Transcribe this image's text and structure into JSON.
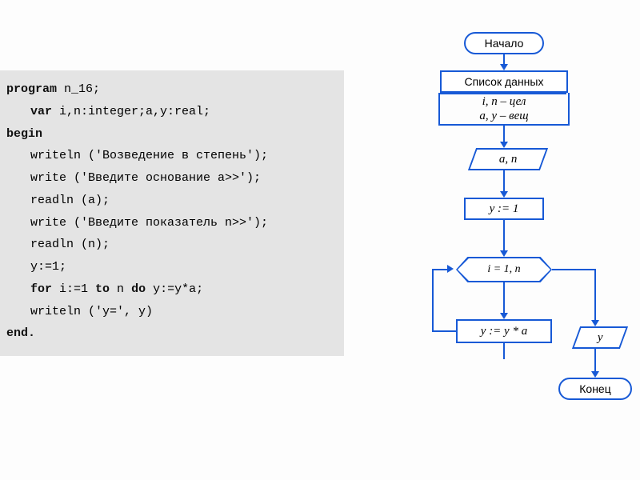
{
  "code": {
    "l1_kw": "program",
    "l1_rest": " n_16;",
    "l2_kw": "var",
    "l2_rest": " i,n:integer;a,y:real;",
    "l3_kw": "begin",
    "l4": "writeln ('Возведение в степень');",
    "l5": "write ('Введите основание a>>');",
    "l6": "readln (a);",
    "l7": "write ('Введите показатель n>>');",
    "l8": "readln (n);",
    "l9": "y:=1;",
    "l10_kw1": "for",
    "l10_mid": " i:=1 ",
    "l10_kw2": "to",
    "l10_mid2": " n ",
    "l10_kw3": "do",
    "l10_rest": " y:=y*a;",
    "l11": "writeln ('y=', y)",
    "l12_kw": "end."
  },
  "flow": {
    "start": "Начало",
    "datalist": "Список данных",
    "types_l1": "i, n – цел",
    "types_l2": "a, y – вещ",
    "input1": "a, n",
    "assign1": "y := 1",
    "loop": "i = 1, n",
    "assign2": "y := y * a",
    "output": "y",
    "end": "Конец"
  }
}
